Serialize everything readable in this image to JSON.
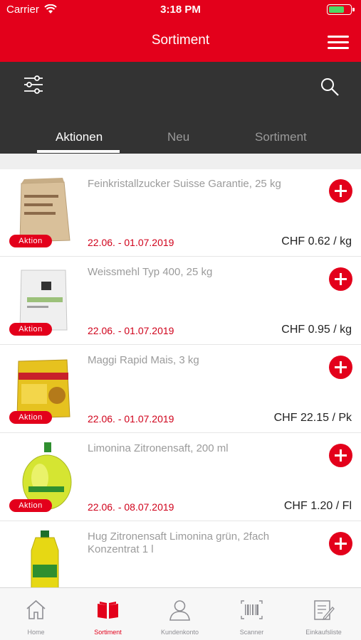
{
  "status_bar": {
    "carrier": "Carrier",
    "time": "3:18 PM"
  },
  "header": {
    "title": "Sortiment"
  },
  "tabs": [
    {
      "label": "Aktionen",
      "active": true
    },
    {
      "label": "Neu",
      "active": false
    },
    {
      "label": "Sortiment",
      "active": false
    }
  ],
  "products": [
    {
      "title": "Feinkristallzucker Suisse Garantie, 25 kg",
      "badge": "Aktion",
      "date": "22.06. - 01.07.2019",
      "price": "CHF 0.62 / kg"
    },
    {
      "title": "Weissmehl Typ 400, 25 kg",
      "badge": "Aktion",
      "date": "22.06. - 01.07.2019",
      "price": "CHF 0.95 / kg"
    },
    {
      "title": "Maggi Rapid Mais, 3 kg",
      "badge": "Aktion",
      "date": "22.06. - 01.07.2019",
      "price": "CHF 22.15 / Pk"
    },
    {
      "title": "Limonina Zitronensaft, 200 ml",
      "badge": "Aktion",
      "date": "22.06. - 08.07.2019",
      "price": "CHF 1.20 / Fl"
    },
    {
      "title": "Hug Zitronensaft Limonina grün, 2fach Konzentrat 1 l"
    }
  ],
  "tabbar": [
    {
      "label": "Home",
      "icon": "home-icon"
    },
    {
      "label": "Sortiment",
      "icon": "book-icon",
      "active": true
    },
    {
      "label": "Kundenkonto",
      "icon": "user-icon"
    },
    {
      "label": "Scanner",
      "icon": "barcode-icon"
    },
    {
      "label": "Einkaufsliste",
      "icon": "edit-list-icon"
    }
  ],
  "colors": {
    "brand_red": "#e3001b",
    "date_red": "#d0021b",
    "toolbar_dark": "#333333"
  }
}
